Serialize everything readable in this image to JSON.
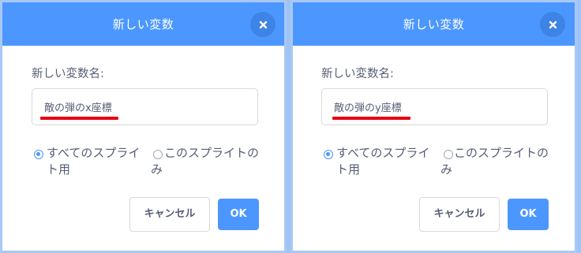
{
  "dialogs": [
    {
      "title": "新しい変数",
      "field_label": "新しい変数名:",
      "input_value": "敵の弾のx座標",
      "radio_all_sprites": "すべてのスプライト用",
      "radio_this_sprite": "このスプライトのみ",
      "selected_option": "all_sprites",
      "cancel_label": "キャンセル",
      "ok_label": "OK",
      "close_icon": "close-icon"
    },
    {
      "title": "新しい変数",
      "field_label": "新しい変数名:",
      "input_value": "敵の弾のy座標",
      "radio_all_sprites": "すべてのスプライト用",
      "radio_this_sprite": "このスプライトのみ",
      "selected_option": "all_sprites",
      "cancel_label": "キャンセル",
      "ok_label": "OK",
      "close_icon": "close-icon"
    }
  ],
  "colors": {
    "accent": "#4c97ff",
    "header_close_bg": "#3d84e6",
    "text": "#575e75",
    "highlight_underline": "#e60012",
    "background": "#9fc3f5"
  }
}
